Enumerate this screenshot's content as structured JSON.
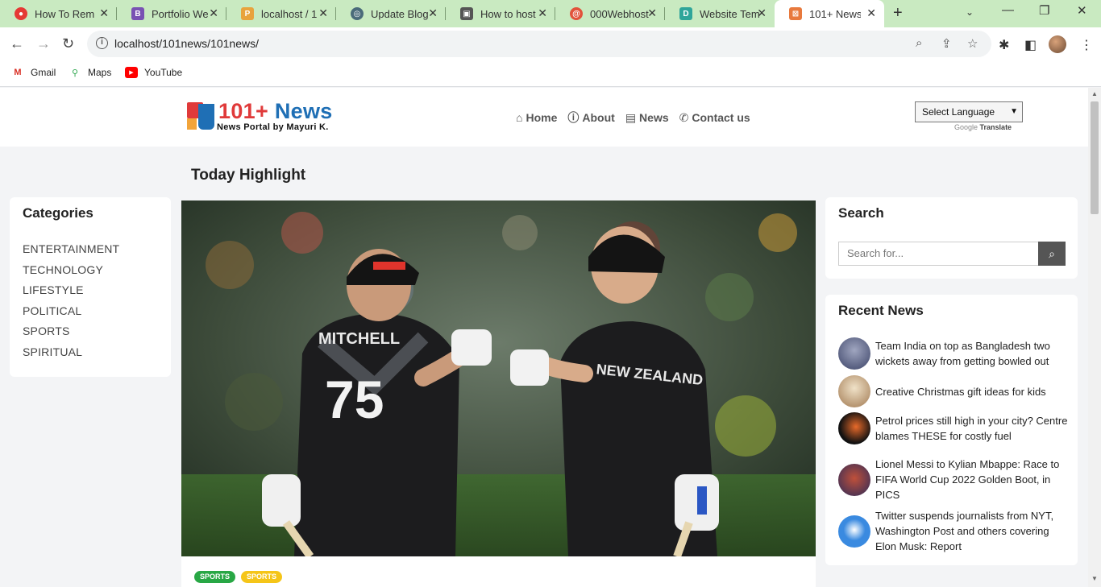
{
  "browser": {
    "tabs": [
      {
        "title": "How To Rem",
        "favicon_color": "#e53935",
        "favicon_glyph": "●"
      },
      {
        "title": "Portfolio We",
        "favicon_color": "#7952b3",
        "favicon_glyph": "B"
      },
      {
        "title": "localhost / 1",
        "favicon_color": "#e8a33d",
        "favicon_glyph": "P"
      },
      {
        "title": "Update Blog",
        "favicon_color": "#4a6b7a",
        "favicon_glyph": "◎"
      },
      {
        "title": "How to host",
        "favicon_color": "#555555",
        "favicon_glyph": "▣"
      },
      {
        "title": "000Webhost",
        "favicon_color": "#e2533b",
        "favicon_glyph": "@"
      },
      {
        "title": "Website Tem",
        "favicon_color": "#2fa59a",
        "favicon_glyph": "D"
      },
      {
        "title": "101+ News",
        "favicon_color": "#e8793d",
        "favicon_glyph": "⊠"
      }
    ],
    "url": "localhost/101news/101news/",
    "bookmarks": [
      {
        "label": "Gmail",
        "icon": "gmail-icon"
      },
      {
        "label": "Maps",
        "icon": "maps-icon"
      },
      {
        "label": "YouTube",
        "icon": "youtube-icon"
      }
    ]
  },
  "site": {
    "logo_number": "101+",
    "logo_word": "News",
    "logo_subtitle": "News Portal by Mayuri K.",
    "nav": [
      {
        "label": "Home",
        "icon": "home-icon"
      },
      {
        "label": "About",
        "icon": "info-icon"
      },
      {
        "label": "News",
        "icon": "newspaper-icon"
      },
      {
        "label": "Contact us",
        "icon": "phone-icon"
      }
    ],
    "language_select": "Select Language",
    "google_label": "Google",
    "translate_label": "Translate"
  },
  "main": {
    "section_title": "Today Highlight",
    "hero_jersey_left_name": "MITCHELL",
    "hero_jersey_left_number": "75",
    "hero_jersey_right_text": "NEW ZEALAND",
    "badges": [
      {
        "label": "SPORTS",
        "color": "#28a745",
        "text_color": "#ffffff"
      },
      {
        "label": "SPORTS",
        "color": "#f5c518",
        "text_color": "#ffffff"
      }
    ]
  },
  "categories": {
    "title": "Categories",
    "items": [
      "ENTERTAINMENT",
      "TECHNOLOGY",
      "LIFESTYLE",
      "POLITICAL",
      "SPORTS",
      "SPIRITUAL"
    ]
  },
  "search": {
    "title": "Search",
    "placeholder": "Search for..."
  },
  "recent": {
    "title": "Recent News",
    "items": [
      "Team India on top as Bangladesh two wickets away from getting bowled out",
      "Creative Christmas gift ideas for kids",
      "Petrol prices still high in your city? Centre blames THESE for costly fuel",
      "Lionel Messi to Kylian Mbappe: Race to FIFA World Cup 2022 Golden Boot, in PICS",
      "Twitter suspends journalists from NYT, Washington Post and others covering Elon Musk: Report"
    ]
  }
}
